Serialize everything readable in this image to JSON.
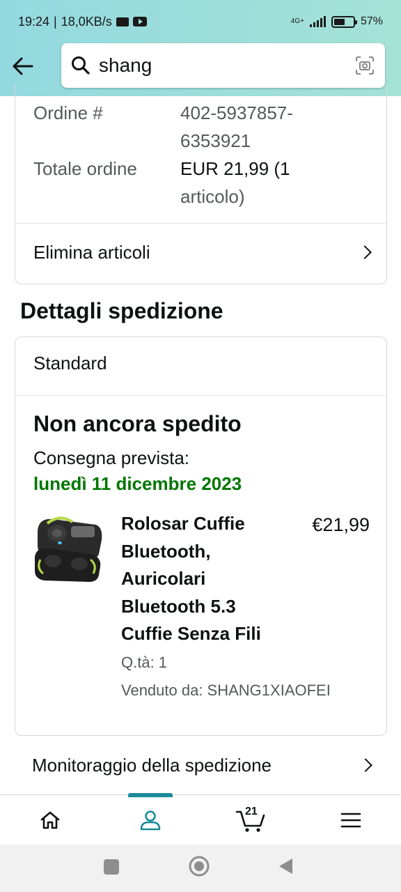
{
  "status_bar": {
    "time": "19:24",
    "speed": "18,0KB/s",
    "network": "4G+",
    "battery": "57%",
    "battery_level": 0.57
  },
  "search": {
    "query": "shang"
  },
  "order": {
    "order_label": "Ordine #",
    "order_number_line1": "402-5937857-",
    "order_number_line2": "6353921",
    "total_label": "Totale ordine",
    "total_line1": "EUR 21,99 (1",
    "total_line2": "articolo)",
    "delete_items": "Elimina articoli"
  },
  "shipping": {
    "heading": "Dettagli spedizione",
    "method": "Standard",
    "status": "Non ancora spedito",
    "delivery_label": "Consegna prevista:",
    "delivery_date": "lunedì 11 dicembre 2023",
    "product": {
      "title": "Rolosar Cuffie Bluetooth, Auricolari Bluetooth 5.3 Cuffie Senza Fili",
      "price": "€21,99",
      "quantity": "Q.tà: 1",
      "sold_by": "Venduto da: SHANG1XIAOFEI"
    },
    "tracking": "Monitoraggio della spedizione"
  },
  "bottom_nav": {
    "items": [
      "home-icon",
      "account-icon",
      "cart-icon",
      "menu-icon"
    ],
    "active": "account-icon",
    "cart_count": "21",
    "accent_color": "#1a8a99"
  },
  "colors": {
    "header_gradient_start": "#93d9e0",
    "header_gradient_end": "#a5e2d6",
    "delivery_green": "#007600"
  }
}
